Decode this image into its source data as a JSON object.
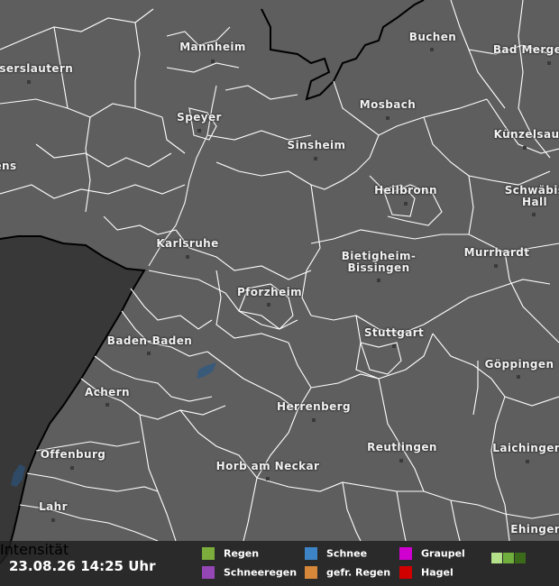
{
  "timestamp": "23.08.26 14:25 Uhr",
  "cities": [
    {
      "id": "mannheim",
      "name": "Mannheim"
    },
    {
      "id": "kaiserslautern",
      "name": "iserslautern"
    },
    {
      "id": "buchen",
      "name": "Buchen"
    },
    {
      "id": "bad-mergentheim",
      "name": "Bad Merge"
    },
    {
      "id": "speyer",
      "name": "Speyer"
    },
    {
      "id": "mosbach",
      "name": "Mosbach"
    },
    {
      "id": "kuenzelsau",
      "name": "Künzelsau"
    },
    {
      "id": "sinsheim",
      "name": "Sinsheim"
    },
    {
      "id": "landau",
      "name": "ens"
    },
    {
      "id": "heilbronn",
      "name": "Heilbronn"
    },
    {
      "id": "schwaebisch-hall",
      "name": "Schwäbis\nHall"
    },
    {
      "id": "karlsruhe",
      "name": "Karlsruhe"
    },
    {
      "id": "bietigheim",
      "name": "Bietigheim-\nBissingen"
    },
    {
      "id": "murrhardt",
      "name": "Murrhardt"
    },
    {
      "id": "pforzheim",
      "name": "Pforzheim"
    },
    {
      "id": "baden-baden",
      "name": "Baden-Baden"
    },
    {
      "id": "stuttgart",
      "name": "Stuttgart"
    },
    {
      "id": "goeppingen",
      "name": "Göppingen"
    },
    {
      "id": "achern",
      "name": "Achern"
    },
    {
      "id": "herrenberg",
      "name": "Herrenberg"
    },
    {
      "id": "offenburg",
      "name": "Offenburg"
    },
    {
      "id": "reutlingen",
      "name": "Reutlingen"
    },
    {
      "id": "laichingen",
      "name": "Laichingen"
    },
    {
      "id": "horb",
      "name": "Horb am Neckar"
    },
    {
      "id": "lahr",
      "name": "Lahr"
    },
    {
      "id": "ehingen",
      "name": "Ehingen"
    }
  ],
  "legend": {
    "items": [
      {
        "id": "regen",
        "label": "Regen",
        "color": "#7cac3c"
      },
      {
        "id": "schnee",
        "label": "Schnee",
        "color": "#3d84c6"
      },
      {
        "id": "graupel",
        "label": "Graupel",
        "color": "#d000d0"
      },
      {
        "id": "schneeregen",
        "label": "Schneeregen",
        "color": "#9446b4"
      },
      {
        "id": "gefr-regen",
        "label": "gefr. Regen",
        "color": "#d6873a"
      },
      {
        "id": "hagel",
        "label": "Hagel",
        "color": "#d00000"
      }
    ],
    "intensity_label": "Intensität",
    "intensity_colors": [
      "#b4e08a",
      "#6fae3d",
      "#3a6a1a"
    ]
  }
}
